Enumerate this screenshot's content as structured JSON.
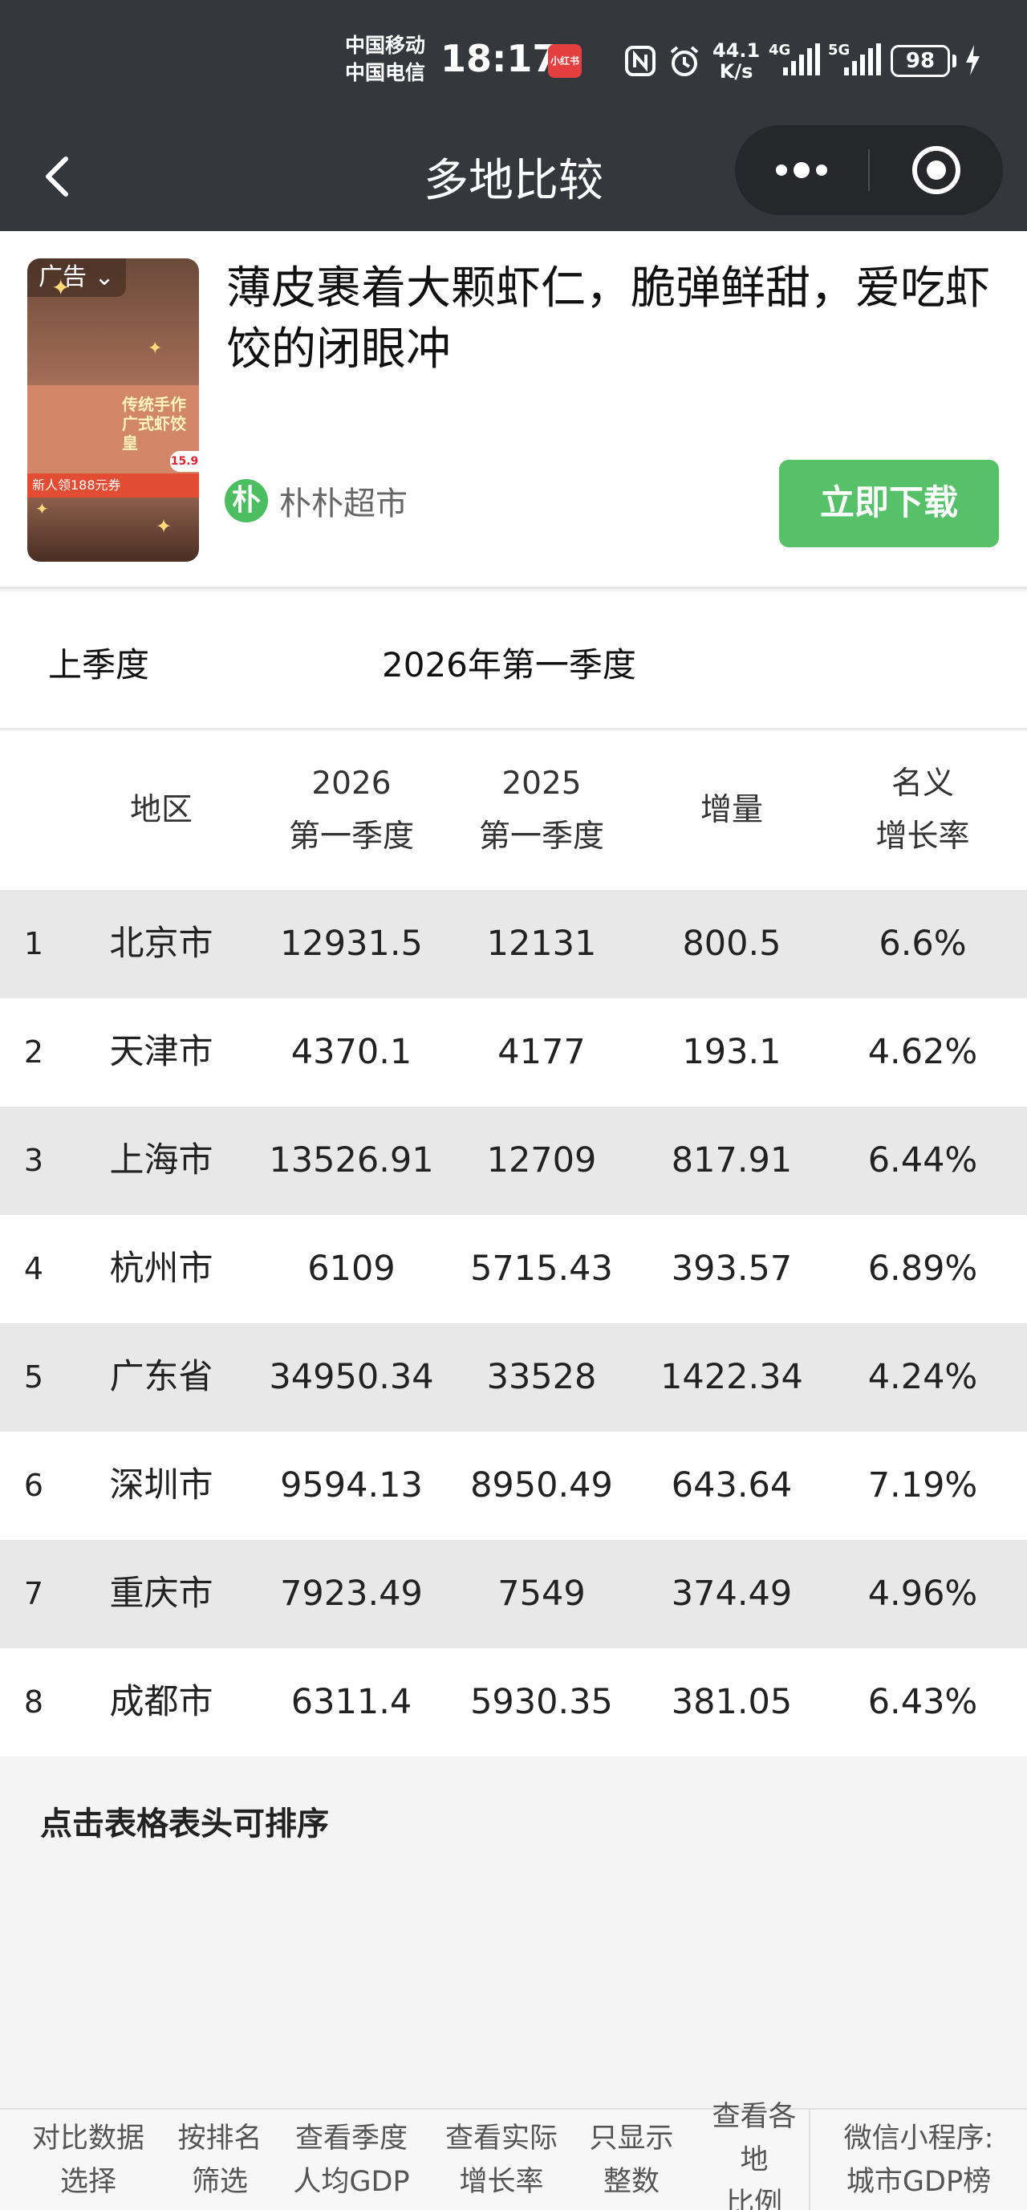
{
  "status_bar": {
    "carrier_1": "中国移动",
    "carrier_2": "中国电信",
    "time": "18:17",
    "app_badge": "小红书",
    "net_speed_value": "44.1",
    "net_speed_unit": "K/s",
    "signal_1_label": "4G",
    "signal_2_label": "5G",
    "battery": "98"
  },
  "nav": {
    "title": "多地比较"
  },
  "ad": {
    "badge": "广告",
    "headline": "薄皮裹着大颗虾仁，脆弹鲜甜，爱吃虾饺的闭眼冲",
    "brand_icon": "朴",
    "brand_name": "朴朴超市",
    "cta": "立即下载",
    "thumb_text_1": "传统手作",
    "thumb_text_2": "广式虾饺皇",
    "thumb_price": "15.9",
    "thumb_strip": "新人领188元券"
  },
  "period": {
    "previous": "上季度",
    "current": "2026年第一季度"
  },
  "table": {
    "headers": {
      "region": "地区",
      "col_a_year": "2026",
      "col_a_period": "第一季度",
      "col_b_year": "2025",
      "col_b_period": "第一季度",
      "increase": "增量",
      "rate_line1": "名义",
      "rate_line2": "增长率"
    },
    "rows": [
      {
        "rank": "1",
        "region": "北京市",
        "a": "12931.5",
        "b": "12131",
        "increase": "800.5",
        "rate": "6.6%"
      },
      {
        "rank": "2",
        "region": "天津市",
        "a": "4370.1",
        "b": "4177",
        "increase": "193.1",
        "rate": "4.62%"
      },
      {
        "rank": "3",
        "region": "上海市",
        "a": "13526.91",
        "b": "12709",
        "increase": "817.91",
        "rate": "6.44%"
      },
      {
        "rank": "4",
        "region": "杭州市",
        "a": "6109",
        "b": "5715.43",
        "increase": "393.57",
        "rate": "6.89%"
      },
      {
        "rank": "5",
        "region": "广东省",
        "a": "34950.34",
        "b": "33528",
        "increase": "1422.34",
        "rate": "4.24%"
      },
      {
        "rank": "6",
        "region": "深圳市",
        "a": "9594.13",
        "b": "8950.49",
        "increase": "643.64",
        "rate": "7.19%"
      },
      {
        "rank": "7",
        "region": "重庆市",
        "a": "7923.49",
        "b": "7549",
        "increase": "374.49",
        "rate": "4.96%"
      },
      {
        "rank": "8",
        "region": "成都市",
        "a": "6311.4",
        "b": "5930.35",
        "increase": "381.05",
        "rate": "6.43%"
      }
    ]
  },
  "sort_hint": "点击表格表头可排序",
  "toolbar": [
    {
      "line1": "对比数据",
      "line2": "选择"
    },
    {
      "line1": "按排名",
      "line2": "筛选"
    },
    {
      "line1": "查看季度",
      "line2": "人均GDP"
    },
    {
      "line1": "查看实际",
      "line2": "增长率"
    },
    {
      "line1": "只显示",
      "line2": "整数"
    },
    {
      "line1": "查看各地",
      "line2": "比例"
    },
    {
      "line1": "微信小程序:",
      "line2": "城市GDP榜"
    }
  ]
}
